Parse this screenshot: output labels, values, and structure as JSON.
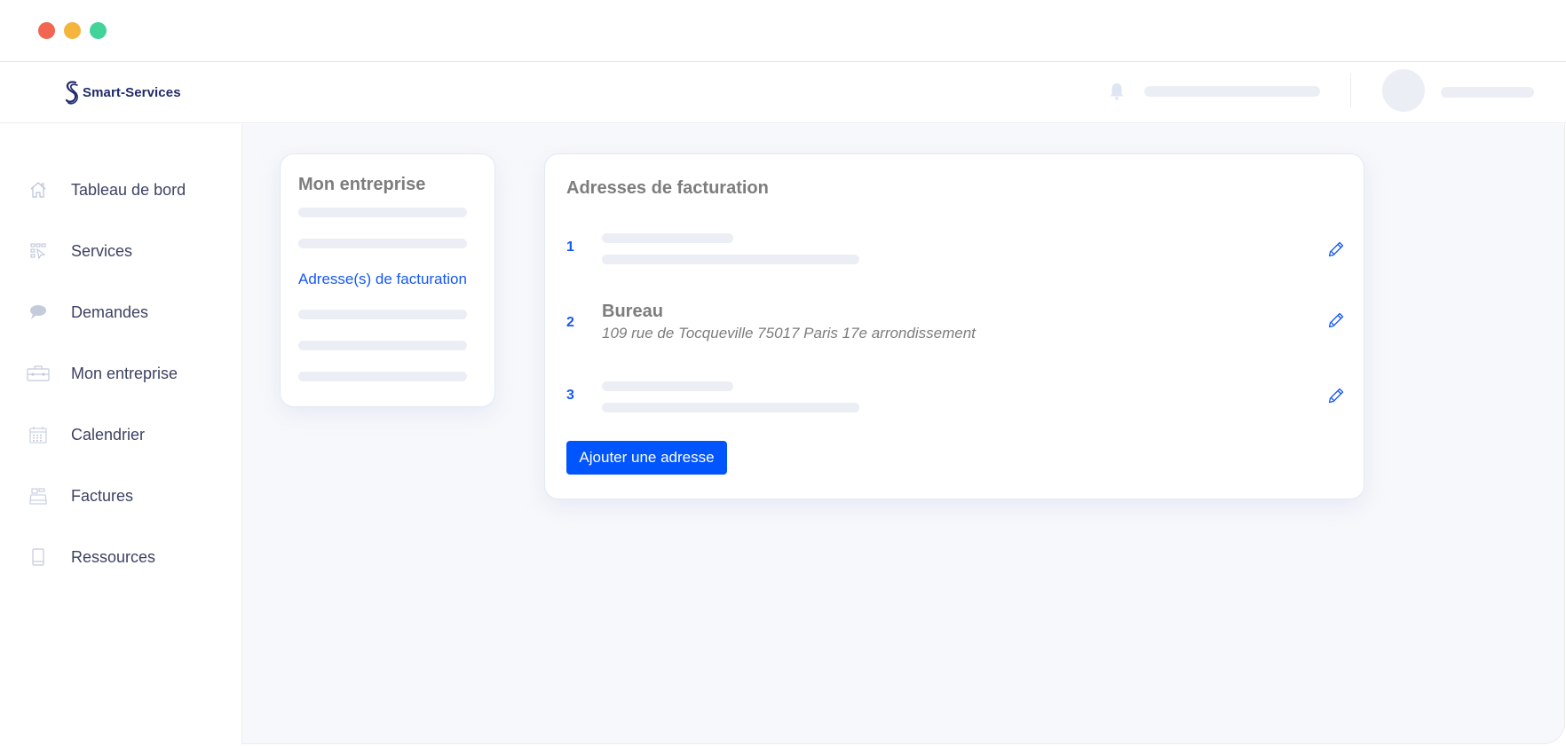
{
  "window": {
    "controls": [
      "close",
      "minimize",
      "maximize"
    ],
    "colors": {
      "close": "#f26551",
      "minimize": "#f5b43c",
      "maximize": "#41d39a"
    }
  },
  "header": {
    "brand": "Smart-Services",
    "logo_icon": "s-logo-icon",
    "notification_icon": "bell-icon"
  },
  "sidebar": {
    "items": [
      {
        "label": "Tableau de bord",
        "icon": "home-icon"
      },
      {
        "label": "Services",
        "icon": "services-grid-cursor-icon"
      },
      {
        "label": "Demandes",
        "icon": "chat-bubble-icon"
      },
      {
        "label": "Mon entreprise",
        "icon": "briefcase-icon"
      },
      {
        "label": "Calendrier",
        "icon": "calendar-icon"
      },
      {
        "label": "Factures",
        "icon": "cash-register-icon"
      },
      {
        "label": "Ressources",
        "icon": "book-icon"
      }
    ]
  },
  "company_menu": {
    "title": "Mon entreprise",
    "active_item": "Adresse(s) de facturation"
  },
  "billing": {
    "title": "Adresses de facturation",
    "addresses": [
      {
        "number": "1",
        "name": null,
        "line": null
      },
      {
        "number": "2",
        "name": "Bureau",
        "line": "109 rue de Tocqueville 75017 Paris 17e arrondissement"
      },
      {
        "number": "3",
        "name": null,
        "line": null
      }
    ],
    "edit_icon": "pencil-icon",
    "add_button_label": "Ajouter une adresse"
  },
  "colors": {
    "accent": "#1558f5",
    "button": "#0055ff",
    "brand": "#1f2a6b",
    "skeleton": "#ebeef5",
    "background": "#f7f8fb"
  }
}
